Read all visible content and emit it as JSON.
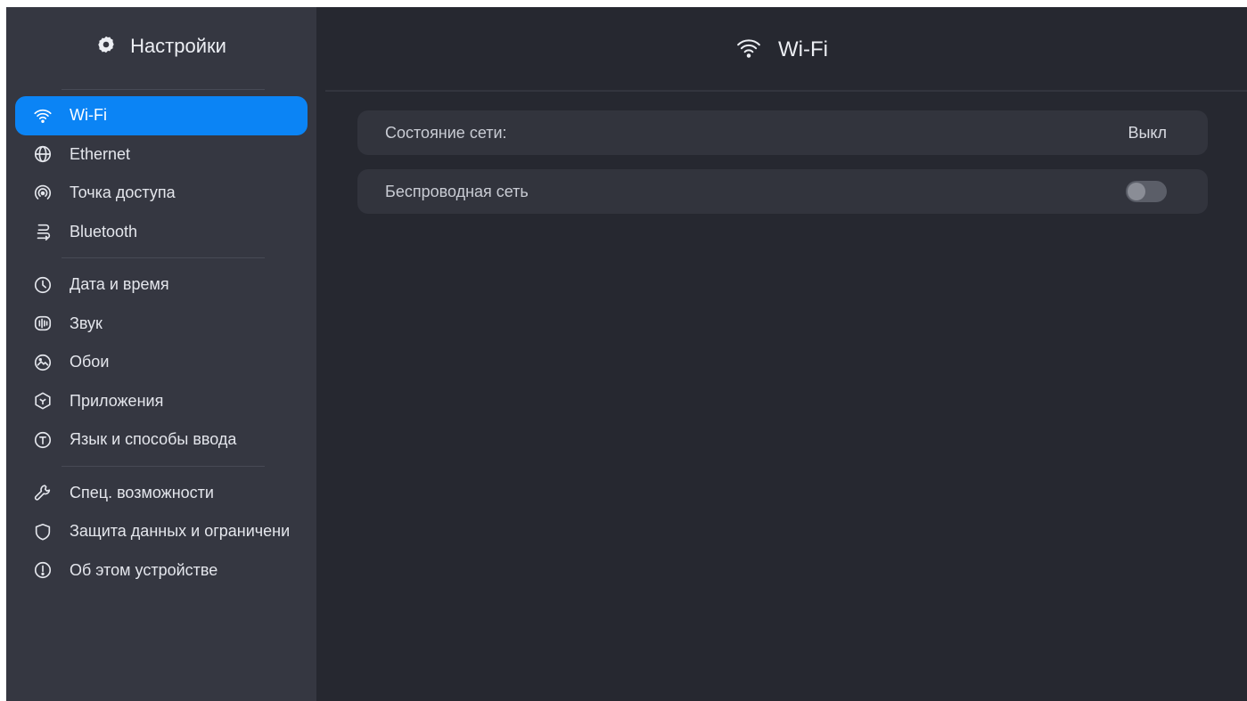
{
  "app": {
    "title": "Настройки",
    "icon": "gear-icon"
  },
  "sidebar": {
    "groups": [
      [
        {
          "key": "wifi",
          "label": "Wi-Fi",
          "icon": "wifi-icon",
          "active": true
        },
        {
          "key": "ethernet",
          "label": "Ethernet",
          "icon": "globe-icon",
          "active": false
        },
        {
          "key": "hotspot",
          "label": "Точка доступа",
          "icon": "hotspot-icon",
          "active": false
        },
        {
          "key": "bluetooth",
          "label": "Bluetooth",
          "icon": "bluetooth-icon",
          "active": false
        }
      ],
      [
        {
          "key": "datetime",
          "label": "Дата и время",
          "icon": "clock-icon",
          "active": false
        },
        {
          "key": "sound",
          "label": "Звук",
          "icon": "sound-icon",
          "active": false
        },
        {
          "key": "wallpaper",
          "label": "Обои",
          "icon": "wallpaper-icon",
          "active": false
        },
        {
          "key": "apps",
          "label": "Приложения",
          "icon": "apps-icon",
          "active": false
        },
        {
          "key": "language",
          "label": "Язык и способы ввода",
          "icon": "language-icon",
          "active": false
        }
      ],
      [
        {
          "key": "accessibility",
          "label": "Спец. возможности",
          "icon": "wrench-icon",
          "active": false
        },
        {
          "key": "privacy",
          "label": "Защита данных и ограничени",
          "icon": "shield-icon",
          "active": false
        },
        {
          "key": "about",
          "label": "Об этом устройстве",
          "icon": "info-icon",
          "active": false
        }
      ]
    ]
  },
  "main": {
    "title": "Wi-Fi",
    "title_icon": "wifi-icon",
    "network_status": {
      "label": "Состояние сети:",
      "value": "Выкл"
    },
    "wireless": {
      "label": "Беспроводная сеть",
      "enabled": false
    }
  },
  "colors": {
    "background": "#262830",
    "sidebar": "#353741",
    "accent": "#0b84f5",
    "row": "#32343d"
  }
}
